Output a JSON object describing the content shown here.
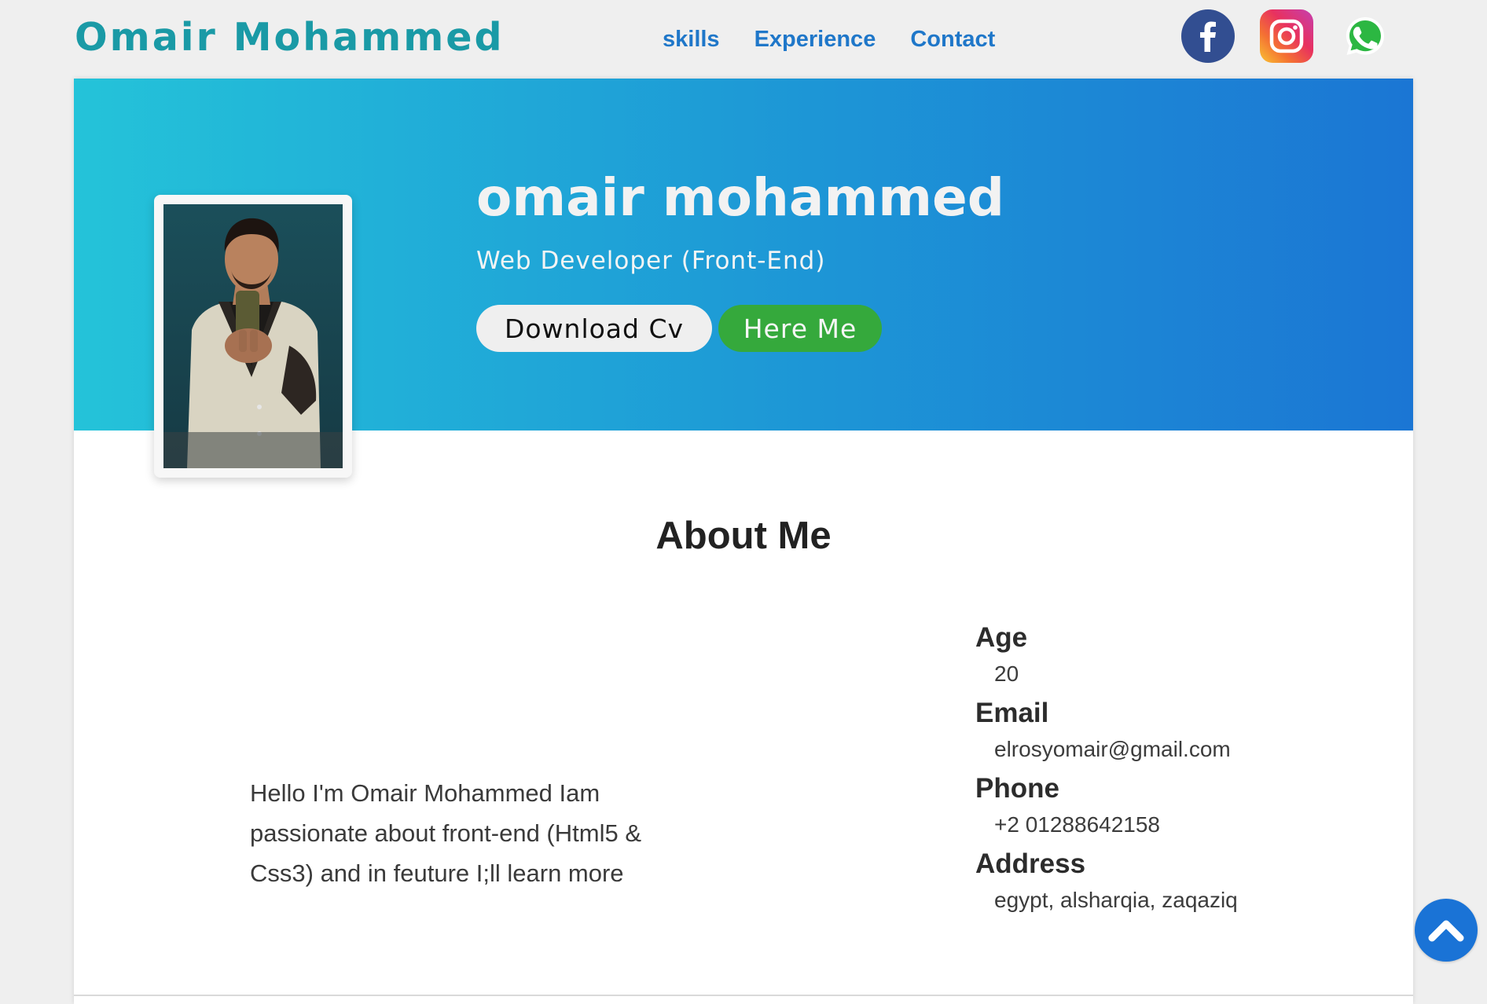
{
  "header": {
    "brand": "Omair Mohammed",
    "nav": [
      "skills",
      "Experience",
      "Contact"
    ],
    "social": [
      "facebook-icon",
      "instagram-icon",
      "whatsapp-icon"
    ]
  },
  "hero": {
    "name": "omair mohammed",
    "role": "Web Developer (Front-End)",
    "download_cv": "Download Cv",
    "hire_me": "Here Me"
  },
  "about": {
    "title": "About Me",
    "text": "Hello I'm Omair Mohammed Iam passionate about front-end (Html5 & Css3) and in feuture I;ll learn more",
    "info": [
      {
        "label": "Age",
        "value": "20"
      },
      {
        "label": "Email",
        "value": "elrosyomair@gmail.com"
      },
      {
        "label": "Phone",
        "value": "+2 01288642158"
      },
      {
        "label": "Address",
        "value": "egypt, alsharqia, zaqaziq"
      }
    ]
  },
  "colors": {
    "brand": "#1a9aa6",
    "nav_link": "#1f77c9",
    "hero_gradient_start": "#24c3d9",
    "hero_gradient_end": "#1b76d4",
    "hire_button": "#35a93c",
    "scroll_top": "#1a73d6"
  },
  "icons": {
    "scroll_top": "chevron-up-icon"
  }
}
